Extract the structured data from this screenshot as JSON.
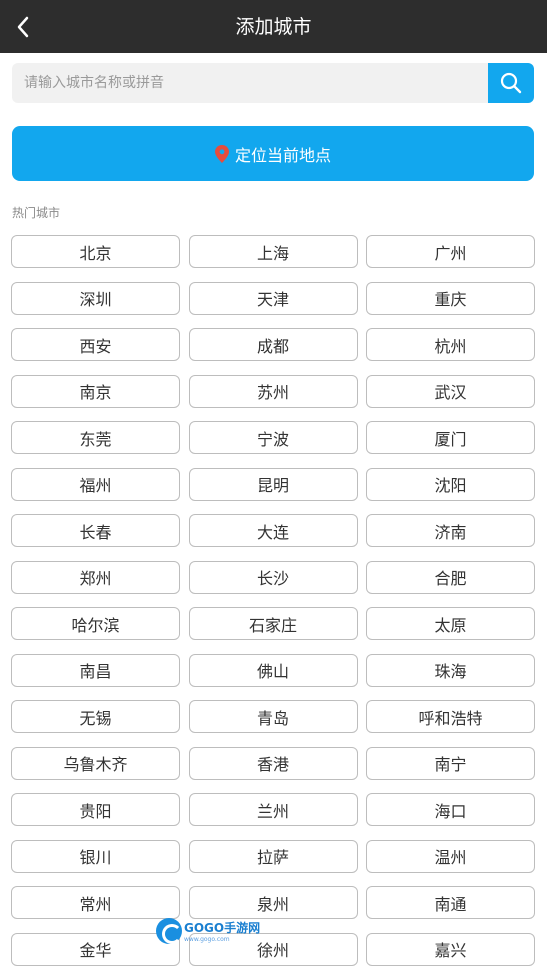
{
  "header": {
    "title": "添加城市",
    "back_icon": "chevron-left-icon"
  },
  "search": {
    "placeholder": "请输入城市名称或拼音",
    "value": "",
    "icon": "search-icon"
  },
  "locate": {
    "label": "定位当前地点",
    "icon": "location-pin-icon"
  },
  "hot_cities": {
    "label": "热门城市",
    "items": [
      "北京",
      "上海",
      "广州",
      "深圳",
      "天津",
      "重庆",
      "西安",
      "成都",
      "杭州",
      "南京",
      "苏州",
      "武汉",
      "东莞",
      "宁波",
      "厦门",
      "福州",
      "昆明",
      "沈阳",
      "长春",
      "大连",
      "济南",
      "郑州",
      "长沙",
      "合肥",
      "哈尔滨",
      "石家庄",
      "太原",
      "南昌",
      "佛山",
      "珠海",
      "无锡",
      "青岛",
      "呼和浩特",
      "乌鲁木齐",
      "香港",
      "南宁",
      "贵阳",
      "兰州",
      "海口",
      "银川",
      "拉萨",
      "温州",
      "常州",
      "泉州",
      "南通",
      "金华",
      "徐州",
      "嘉兴"
    ]
  },
  "watermark": {
    "text": "GOGO手游网",
    "sub": "www.gogo.com"
  },
  "colors": {
    "accent": "#12a7ee",
    "header_bg": "#2d2d2d",
    "pin": "#e74c3c"
  }
}
